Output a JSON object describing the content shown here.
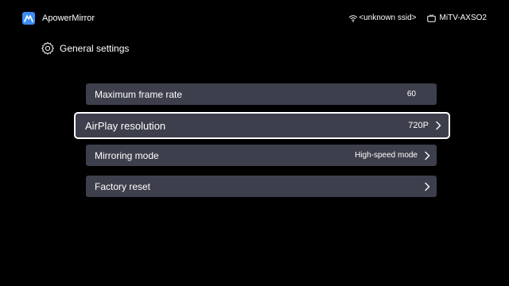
{
  "app": {
    "name": "ApowerMirror",
    "logo_icon": "apowermirror-logo-icon",
    "accent_color": "#3b8cf5"
  },
  "status": {
    "wifi_icon": "wifi-icon",
    "ssid": "<unknown ssid>",
    "tv_icon": "tv-icon",
    "device_name": "MiTV-AXSO2"
  },
  "header": {
    "icon": "gear-icon",
    "title": "General settings"
  },
  "settings": [
    {
      "label": "Maximum frame rate",
      "value": "60"
    },
    {
      "label": "AirPlay resolution",
      "value": "720P",
      "focused": true
    },
    {
      "label": "Mirroring mode",
      "value": "High-speed mode"
    },
    {
      "label": "Factory reset",
      "value": ""
    }
  ]
}
